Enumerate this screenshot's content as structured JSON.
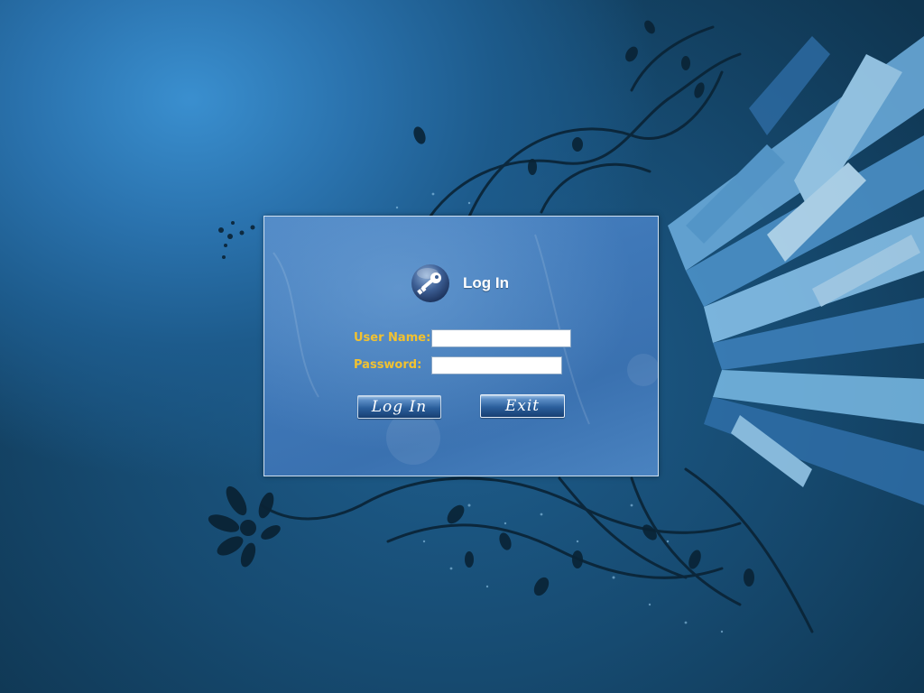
{
  "dialog": {
    "title": "Log In",
    "title_icon": "key-icon",
    "username_label": "User Name:",
    "username_value": "",
    "password_label": "Password:",
    "password_value": "",
    "login_button_label": "Log In",
    "exit_button_label": "Exit"
  },
  "colors": {
    "label_color": "#f2c230",
    "dialog_background": "#3f78b8",
    "desktop_background": "#1d5b8c"
  }
}
